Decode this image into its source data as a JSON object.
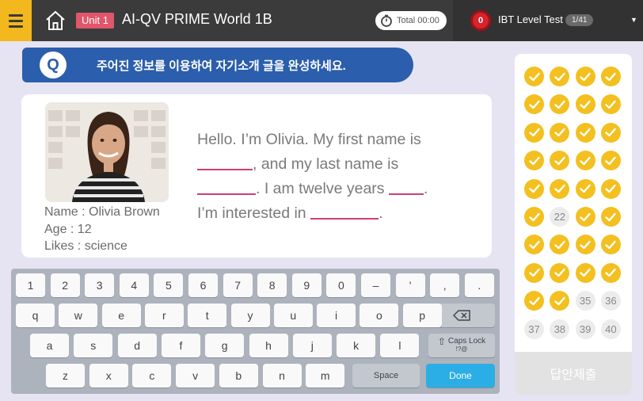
{
  "topbar": {
    "unit": "Unit 1",
    "title": "AI-QV PRIME World 1B",
    "timer": "Total 00:00",
    "test_name": "IBT Level Test",
    "test_progress": "1/41",
    "dropdown_icon": "chevron-down-icon"
  },
  "question": {
    "marker": "Q",
    "instruction": "주어진 정보를 이용하여 자기소개 글을 완성하세요."
  },
  "profile": {
    "name": "Name : Olivia Brown",
    "age": "Age : 12",
    "likes": "Likes : science"
  },
  "passage": {
    "l1": "Hello. I’m Olivia. My first name is",
    "l2": ", and my last name is",
    "l3a": ". I am twelve years",
    "l3b": ".",
    "l4a": "I’m interested in",
    "l4b": "."
  },
  "keyboard": {
    "row1": [
      "1",
      "2",
      "3",
      "4",
      "5",
      "6",
      "7",
      "8",
      "9",
      "0",
      "–",
      "'",
      ",",
      "."
    ],
    "row2": [
      "q",
      "w",
      "e",
      "r",
      "t",
      "y",
      "u",
      "i",
      "o",
      "p"
    ],
    "row3": [
      "a",
      "s",
      "d",
      "f",
      "g",
      "h",
      "j",
      "k",
      "l"
    ],
    "row4": [
      "z",
      "x",
      "c",
      "v",
      "b",
      "n",
      "m"
    ],
    "backspace_icon": "backspace-icon",
    "caps_lock": "Caps Lock",
    "caps_sub": "!?@",
    "space": "Space",
    "done": "Done"
  },
  "answer_sheet": {
    "answered": [
      1,
      2,
      3,
      4,
      5,
      6,
      7,
      8,
      9,
      10,
      11,
      12,
      13,
      14,
      15,
      16,
      17,
      18,
      19,
      20,
      21,
      23,
      24,
      25,
      26,
      27,
      28,
      29,
      30,
      31,
      32,
      33,
      34
    ],
    "unanswered_labels": [
      "22",
      "35",
      "36",
      "37",
      "38",
      "39",
      "40"
    ],
    "submit_label": "답안제출"
  },
  "colors": {
    "accent_yellow": "#f3c020",
    "question_blue": "#2b5eac",
    "blank_pink": "#cf3d77",
    "done_blue": "#2aaee5"
  }
}
